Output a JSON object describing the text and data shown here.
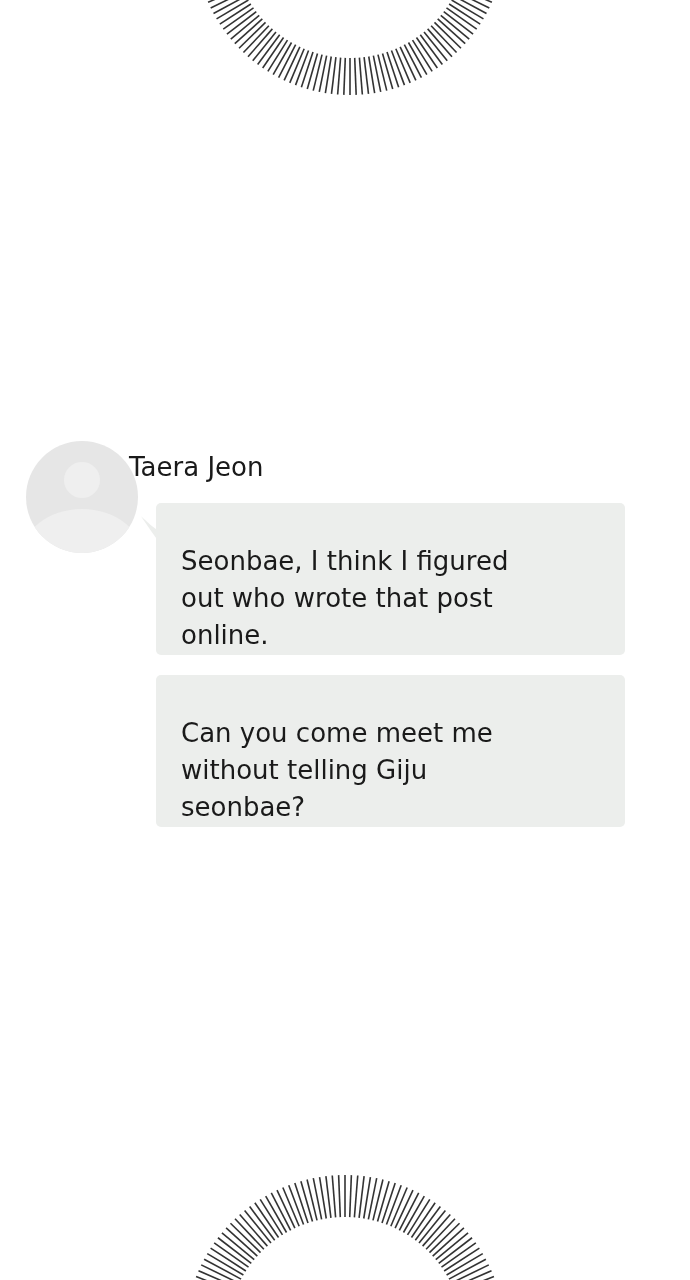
{
  "chat": {
    "sender": {
      "name": "Taera Jeon"
    },
    "messages": [
      {
        "text": "Seonbae, I think I figured out who wrote that post online."
      },
      {
        "text": "Can you come meet me without telling Giju seonbae?"
      }
    ]
  }
}
